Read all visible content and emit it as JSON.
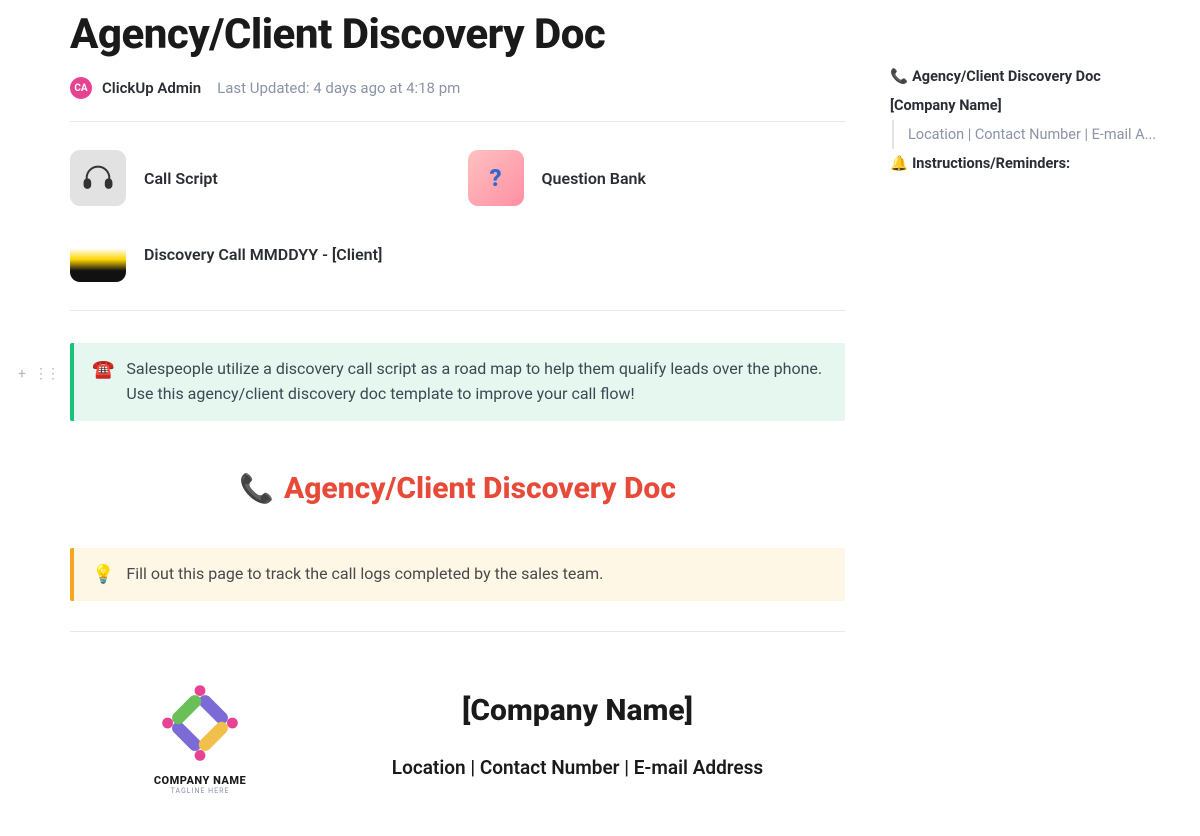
{
  "header": {
    "title": "Agency/Client Discovery Doc",
    "author_initials": "CA",
    "author_name": "ClickUp Admin",
    "updated_label": "Last Updated:",
    "updated_value": "4 days ago at 4:18 pm"
  },
  "subpages": [
    {
      "label": "Call Script",
      "icon": "headset"
    },
    {
      "label": "Question Bank",
      "icon": "question"
    },
    {
      "label": "Discovery Call MMDDYY - [Client]",
      "icon": "stack"
    }
  ],
  "callout_green": {
    "icon": "☎️",
    "text": "Salespeople utilize a discovery call script as a road map to help them qualify leads over the phone. Use this agency/client discovery doc template to improve your call flow!"
  },
  "doc_heading": {
    "icon": "📞",
    "text": "Agency/Client Discovery Doc"
  },
  "callout_yellow": {
    "icon": "💡",
    "text": "Fill out this page to track the call logs completed by the sales team."
  },
  "company": {
    "logo_name": "COMPANY NAME",
    "logo_tagline": "TAGLINE HERE",
    "name": "[Company Name]",
    "contact": "Location | Contact Number | E-mail Address"
  },
  "outline": {
    "items": [
      {
        "emoji": "📞",
        "label": "Agency/Client Discovery Doc",
        "bold": true
      },
      {
        "label": "[Company Name]",
        "bold": true
      },
      {
        "label": "Location | Contact Number | E-mail A...",
        "sub": true
      },
      {
        "emoji": "🔔",
        "label": "Instructions/Reminders:",
        "bold": true
      }
    ]
  }
}
